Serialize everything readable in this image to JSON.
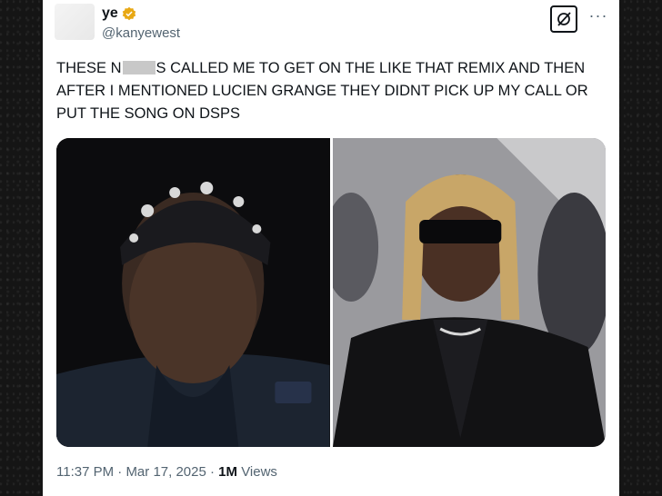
{
  "user": {
    "display_name": "ye",
    "handle": "@kanyewest"
  },
  "tweet": {
    "text_part1": "THESE N",
    "text_part2": "S CALLED ME TO GET ON THE LIKE THAT REMIX AND THEN AFTER I MENTIONED LUCIEN GRANGE THEY DIDNT PICK UP MY CALL OR PUT THE SONG ON DSPs",
    "time": "11:37 PM",
    "separator": "·",
    "date": "Mar 17, 2025",
    "views_count": "1M",
    "views_label": "Views"
  },
  "icons": {
    "verified": "verified-badge-icon",
    "grok": "grok-icon",
    "more": "more-icon"
  },
  "colors": {
    "verified": "#e8a814",
    "text": "#0f1419",
    "secondary": "#536471"
  }
}
